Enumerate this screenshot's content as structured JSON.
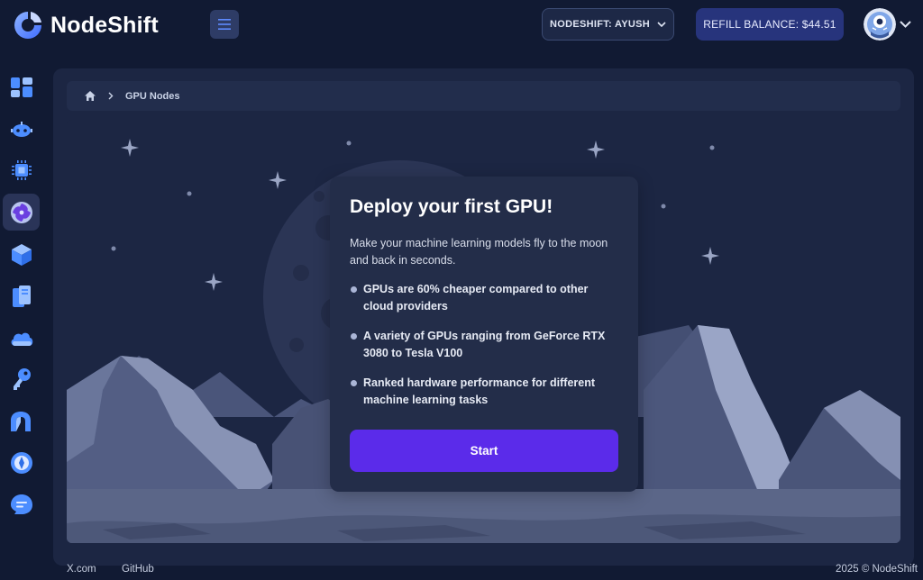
{
  "brand": {
    "name": "NodeShift"
  },
  "header": {
    "menu_icon": "hamburger-icon",
    "account_label": "NODESHIFT: AYUSH",
    "refill_label": "REFILL BALANCE:",
    "refill_amount": "$44.51"
  },
  "sidebar": {
    "items": [
      {
        "name": "dashboard",
        "icon": "dashboard-grid-icon",
        "active": false
      },
      {
        "name": "bots",
        "icon": "robot-icon",
        "active": false
      },
      {
        "name": "compute",
        "icon": "cpu-chip-icon",
        "active": false
      },
      {
        "name": "gpu-nodes",
        "icon": "gpu-swirl-icon",
        "active": true
      },
      {
        "name": "containers",
        "icon": "cube-icon",
        "active": false
      },
      {
        "name": "storage",
        "icon": "storage-buckets-icon",
        "active": false
      },
      {
        "name": "cloud",
        "icon": "cloud-icon",
        "active": false
      },
      {
        "name": "keys",
        "icon": "key-icon",
        "active": false
      },
      {
        "name": "network",
        "icon": "arch-icon",
        "active": false
      },
      {
        "name": "integrations",
        "icon": "compass-icon",
        "active": false
      },
      {
        "name": "support",
        "icon": "chat-bubble-icon",
        "active": false
      }
    ]
  },
  "breadcrumb": {
    "current": "GPU Nodes"
  },
  "card": {
    "title": "Deploy your first GPU!",
    "description": "Make your machine learning models fly to the moon and back in seconds.",
    "bullets": [
      "GPUs are 60% cheaper compared to other cloud providers",
      "A variety of GPUs ranging from GeForce RTX 3080 to Tesla V100",
      "Ranked hardware performance for different machine learning tasks"
    ],
    "start_label": "Start"
  },
  "footer": {
    "link_x": "X.com",
    "link_github": "GitHub",
    "copyright": "2025 © NodeShift"
  },
  "colors": {
    "background": "#111a33",
    "panel": "#1c2643",
    "card": "#232d49",
    "accent": "#5b2bea",
    "refill": "#27347c",
    "icon_blue": "#3b82f6"
  }
}
